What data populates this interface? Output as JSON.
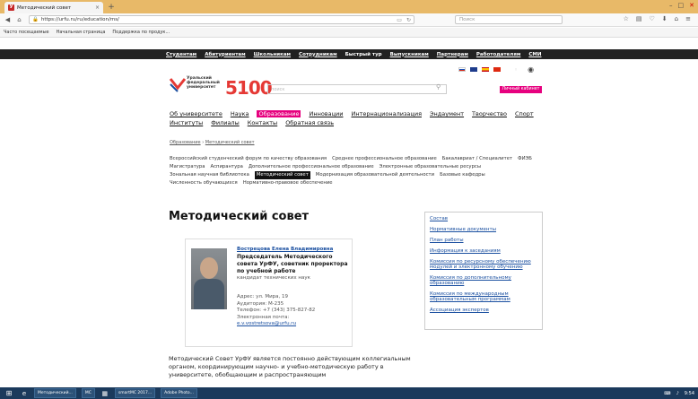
{
  "browser": {
    "tab_title": "Методический совет",
    "favicon_letter": "У",
    "new_tab": "+",
    "close_tab": "×",
    "url": "https://urfu.ru/ru/education/ms/",
    "search_placeholder": "Поиск",
    "bookmarks": [
      "Часто посещаемые",
      "Начальная страница",
      "Поддержка по продук..."
    ],
    "win_min": "–",
    "win_max": "□",
    "win_close": "✕"
  },
  "site": {
    "topnav": [
      "Студентам",
      "Абитуриентам",
      "Школьникам",
      "Сотрудникам",
      "Быстрый тур",
      "Выпускникам",
      "Партнерам",
      "Работодателям",
      "СМИ"
    ],
    "logo_text": [
      "Уральский",
      "федеральный",
      "университет"
    ],
    "logo_5100": "5100",
    "search_placeholder": "поиск",
    "cabinet_button": "Личный кабинет",
    "mainmenu_row1": [
      "Об университете",
      "Наука",
      "Образование",
      "Инновации",
      "Интернационализация",
      "Эндаумент",
      "Творчество",
      "Спорт"
    ],
    "mainmenu_row2": [
      "Институты",
      "Филиалы",
      "Контакты",
      "Обратная связь"
    ],
    "breadcrumb_link": "Образование",
    "breadcrumb_sep": "›",
    "breadcrumb_current": "Методический совет",
    "submenu_row1": [
      "Всероссийский студенческий форум по качеству образования",
      "Среднее профессиональное образование",
      "Бакалавриат / Специалитет",
      "ФИЭБ"
    ],
    "submenu_row2": [
      "Магистратура",
      "Аспирантура",
      "Дополнительное профессиональное образование",
      "Электронные образовательные ресурсы"
    ],
    "submenu_row3": [
      "Зональная научная библиотека",
      "Методический совет",
      "Модернизация образовательной деятельности",
      "Базовые кафедры"
    ],
    "submenu_row4": [
      "Численность обучающихся",
      "Нормативно-правовое обеспечение"
    ],
    "page_title": "Методический совет",
    "person": {
      "name": "Вострецова Елена Владимировна",
      "role": "Председатель Методического совета УрФУ, советник проректора по учебной работе",
      "degree": "кандидат технических наук",
      "address": "Адрес: ул. Мира, 19",
      "room": "Аудитория: М-235",
      "phone": "Телефон: +7 (343) 375-827-82",
      "email_label": "Электронная почта:",
      "email": "e.v.vostretsova@urfu.ru"
    },
    "side_links": [
      "Состав",
      "Нормативные документы",
      "План работы",
      "Информация к заседаниям",
      "Комиссия по ресурсному обеспечению модулей и электронному обучению",
      "Комиссия по дополнительному образованию",
      "Комиссия по международным образовательным программам",
      "Ассоциация экспертов"
    ],
    "body_text": "Методический Совет УрФУ является постоянно действующим коллегиальным органом, координирующим научно- и учебно-методическую работу в университете, обобщающим и распространяющим"
  },
  "taskbar": {
    "items": [
      "Методический...",
      "MC",
      "",
      "smartMC 2017...",
      "Adobe Photo..."
    ],
    "time": "9:54"
  }
}
